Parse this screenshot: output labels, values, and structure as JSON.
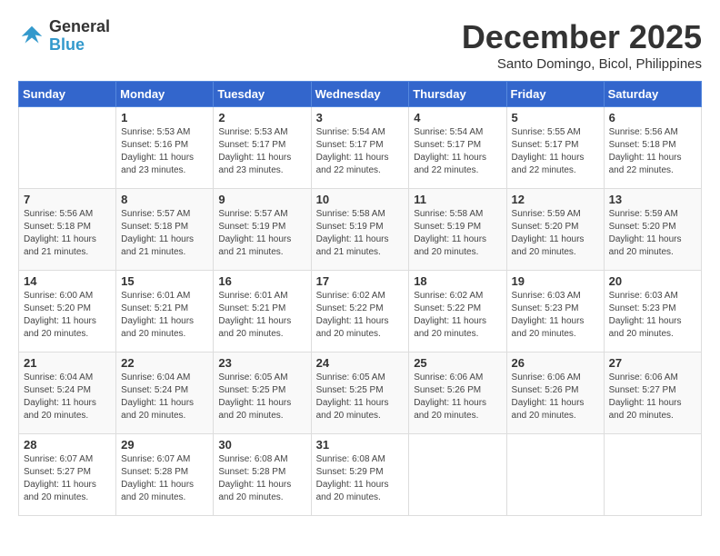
{
  "logo": {
    "line1": "General",
    "line2": "Blue"
  },
  "title": "December 2025",
  "location": "Santo Domingo, Bicol, Philippines",
  "weekdays": [
    "Sunday",
    "Monday",
    "Tuesday",
    "Wednesday",
    "Thursday",
    "Friday",
    "Saturday"
  ],
  "weeks": [
    [
      {
        "day": "",
        "info": ""
      },
      {
        "day": "1",
        "info": "Sunrise: 5:53 AM\nSunset: 5:16 PM\nDaylight: 11 hours\nand 23 minutes."
      },
      {
        "day": "2",
        "info": "Sunrise: 5:53 AM\nSunset: 5:17 PM\nDaylight: 11 hours\nand 23 minutes."
      },
      {
        "day": "3",
        "info": "Sunrise: 5:54 AM\nSunset: 5:17 PM\nDaylight: 11 hours\nand 22 minutes."
      },
      {
        "day": "4",
        "info": "Sunrise: 5:54 AM\nSunset: 5:17 PM\nDaylight: 11 hours\nand 22 minutes."
      },
      {
        "day": "5",
        "info": "Sunrise: 5:55 AM\nSunset: 5:17 PM\nDaylight: 11 hours\nand 22 minutes."
      },
      {
        "day": "6",
        "info": "Sunrise: 5:56 AM\nSunset: 5:18 PM\nDaylight: 11 hours\nand 22 minutes."
      }
    ],
    [
      {
        "day": "7",
        "info": "Sunrise: 5:56 AM\nSunset: 5:18 PM\nDaylight: 11 hours\nand 21 minutes."
      },
      {
        "day": "8",
        "info": "Sunrise: 5:57 AM\nSunset: 5:18 PM\nDaylight: 11 hours\nand 21 minutes."
      },
      {
        "day": "9",
        "info": "Sunrise: 5:57 AM\nSunset: 5:19 PM\nDaylight: 11 hours\nand 21 minutes."
      },
      {
        "day": "10",
        "info": "Sunrise: 5:58 AM\nSunset: 5:19 PM\nDaylight: 11 hours\nand 21 minutes."
      },
      {
        "day": "11",
        "info": "Sunrise: 5:58 AM\nSunset: 5:19 PM\nDaylight: 11 hours\nand 20 minutes."
      },
      {
        "day": "12",
        "info": "Sunrise: 5:59 AM\nSunset: 5:20 PM\nDaylight: 11 hours\nand 20 minutes."
      },
      {
        "day": "13",
        "info": "Sunrise: 5:59 AM\nSunset: 5:20 PM\nDaylight: 11 hours\nand 20 minutes."
      }
    ],
    [
      {
        "day": "14",
        "info": "Sunrise: 6:00 AM\nSunset: 5:20 PM\nDaylight: 11 hours\nand 20 minutes."
      },
      {
        "day": "15",
        "info": "Sunrise: 6:01 AM\nSunset: 5:21 PM\nDaylight: 11 hours\nand 20 minutes."
      },
      {
        "day": "16",
        "info": "Sunrise: 6:01 AM\nSunset: 5:21 PM\nDaylight: 11 hours\nand 20 minutes."
      },
      {
        "day": "17",
        "info": "Sunrise: 6:02 AM\nSunset: 5:22 PM\nDaylight: 11 hours\nand 20 minutes."
      },
      {
        "day": "18",
        "info": "Sunrise: 6:02 AM\nSunset: 5:22 PM\nDaylight: 11 hours\nand 20 minutes."
      },
      {
        "day": "19",
        "info": "Sunrise: 6:03 AM\nSunset: 5:23 PM\nDaylight: 11 hours\nand 20 minutes."
      },
      {
        "day": "20",
        "info": "Sunrise: 6:03 AM\nSunset: 5:23 PM\nDaylight: 11 hours\nand 20 minutes."
      }
    ],
    [
      {
        "day": "21",
        "info": "Sunrise: 6:04 AM\nSunset: 5:24 PM\nDaylight: 11 hours\nand 20 minutes."
      },
      {
        "day": "22",
        "info": "Sunrise: 6:04 AM\nSunset: 5:24 PM\nDaylight: 11 hours\nand 20 minutes."
      },
      {
        "day": "23",
        "info": "Sunrise: 6:05 AM\nSunset: 5:25 PM\nDaylight: 11 hours\nand 20 minutes."
      },
      {
        "day": "24",
        "info": "Sunrise: 6:05 AM\nSunset: 5:25 PM\nDaylight: 11 hours\nand 20 minutes."
      },
      {
        "day": "25",
        "info": "Sunrise: 6:06 AM\nSunset: 5:26 PM\nDaylight: 11 hours\nand 20 minutes."
      },
      {
        "day": "26",
        "info": "Sunrise: 6:06 AM\nSunset: 5:26 PM\nDaylight: 11 hours\nand 20 minutes."
      },
      {
        "day": "27",
        "info": "Sunrise: 6:06 AM\nSunset: 5:27 PM\nDaylight: 11 hours\nand 20 minutes."
      }
    ],
    [
      {
        "day": "28",
        "info": "Sunrise: 6:07 AM\nSunset: 5:27 PM\nDaylight: 11 hours\nand 20 minutes."
      },
      {
        "day": "29",
        "info": "Sunrise: 6:07 AM\nSunset: 5:28 PM\nDaylight: 11 hours\nand 20 minutes."
      },
      {
        "day": "30",
        "info": "Sunrise: 6:08 AM\nSunset: 5:28 PM\nDaylight: 11 hours\nand 20 minutes."
      },
      {
        "day": "31",
        "info": "Sunrise: 6:08 AM\nSunset: 5:29 PM\nDaylight: 11 hours\nand 20 minutes."
      },
      {
        "day": "",
        "info": ""
      },
      {
        "day": "",
        "info": ""
      },
      {
        "day": "",
        "info": ""
      }
    ]
  ]
}
